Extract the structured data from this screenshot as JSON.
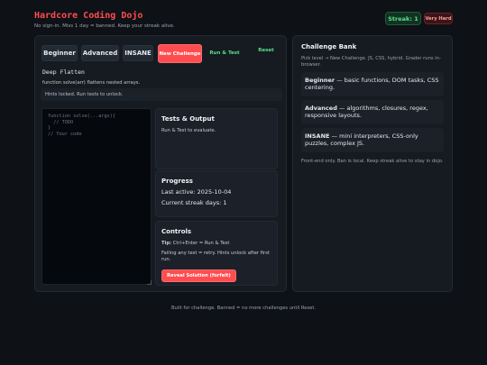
{
  "header": {
    "title": "Hardcore Coding Dojo",
    "subtitle": "No sign-in. Miss 1 day = banned. Keep your streak alive.",
    "streak_label": "Streak: 1",
    "difficulty": "Very Hard"
  },
  "toolbar": {
    "levels": [
      "Beginner",
      "Advanced",
      "INSANE"
    ],
    "new_challenge": "New Challenge",
    "run_test": "Run & Test",
    "reset": "Reset"
  },
  "challenge": {
    "name": "Deep Flatten",
    "description": "function solve(arr) flattens nested arrays.",
    "hint": "Hints locked. Run tests to unlock."
  },
  "editor": {
    "code": "function solve(...args){\n  // TODO\n}\n// Your code"
  },
  "tests": {
    "title": "Tests & Output",
    "message": "Run & Test to evaluate."
  },
  "progress": {
    "title": "Progress",
    "last_active": "Last active: 2025-10-04",
    "streak_days": "Current streak days: 1"
  },
  "controls": {
    "title": "Controls",
    "tip_label": "Tip:",
    "tip": " Ctrl+Enter = Run & Test",
    "retry_note": "Failing any test = retry. Hints unlock after first run.",
    "reveal": "Reveal Solution (forfeit)"
  },
  "bank": {
    "title": "Challenge Bank",
    "subtitle": "Pick level → New Challenge. JS, CSS, hybrid. Grader runs in-browser.",
    "items": [
      {
        "level": "Beginner",
        "desc": " — basic functions, DOM tasks, CSS centering."
      },
      {
        "level": "Advanced",
        "desc": " — algorithms, closures, regex, responsive layouts."
      },
      {
        "level": "INSANE",
        "desc": " — mini interpreters, CSS-only puzzles, complex JS."
      }
    ],
    "footer": "Front-end only. Ban is local. Keep streak alive to stay in dojo."
  },
  "footer": "Built for challenge. Banned = no more challenges until Reset.",
  "colors": {
    "accent": "#ff4d4f",
    "success": "#58e08a",
    "background": "#0e1116"
  }
}
